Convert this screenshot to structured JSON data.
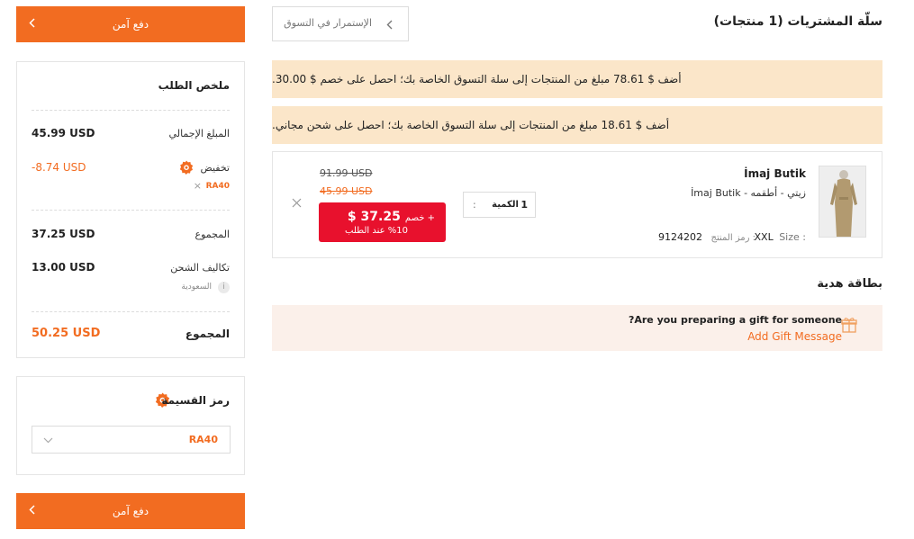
{
  "colors": {
    "accent": "#f26c21",
    "sale_red": "#e8112d",
    "banner_bg": "#fbe6c9",
    "gift_bg": "#fbf0ea"
  },
  "header": {
    "cart_title": "سلّة المشتريات (1 منتجات)",
    "continue_shopping": "الإستمرار في التسوق"
  },
  "banners": [
    "أضف $ 78.61 مبلغ من المنتجات إلى سلة التسوق الخاصة بك؛ احصل على خصم $ 30.00.",
    "أضف $ 18.61 مبلغ من المنتجات إلى سلة التسوق الخاصة بك؛ احصل على شحن مجاني."
  ],
  "product": {
    "brand": "İmaj Butik",
    "subtitle": "زيتي - أطقمه - İmaj Butik",
    "size_label": "Size :",
    "size_value": "XXL",
    "code_label": "رمز المنتج :",
    "code_value": "9124202",
    "qty_label": "الكمية",
    "qty_value": "1",
    "old_price": "91.99 USD",
    "sale_price": "45.99 USD",
    "promo_price": "37.25 $",
    "promo_plus": "+ خصم",
    "promo_note": "%10 عند الطلب",
    "remove_icon": "close-icon"
  },
  "gift": {
    "section_title": "بطاقة هدية",
    "question": "?Are you preparing a gift for someone",
    "link": "Add Gift Message",
    "icon": "gift-icon"
  },
  "pay_button": {
    "label": "دفع آمن",
    "icon": "chevron-left-icon"
  },
  "summary": {
    "title": "ملخص الطلب",
    "subtotal_label": "المبلغ الإجمالي",
    "subtotal_value": "45.99 USD",
    "discount_label": "تخفيض",
    "discount_value": "-8.74 USD",
    "discount_code": "RA40",
    "total_label": "المجموع",
    "total_value": "37.25 USD",
    "shipping_label": "تكاليف الشحن",
    "shipping_value": "13.00 USD",
    "shipping_country": "السعودية",
    "grand_total_label": "المجموع",
    "grand_total_value": "50.25 USD"
  },
  "coupon": {
    "title": "رمز القسيمة",
    "selected": "RA40",
    "icon": "badge-icon"
  }
}
